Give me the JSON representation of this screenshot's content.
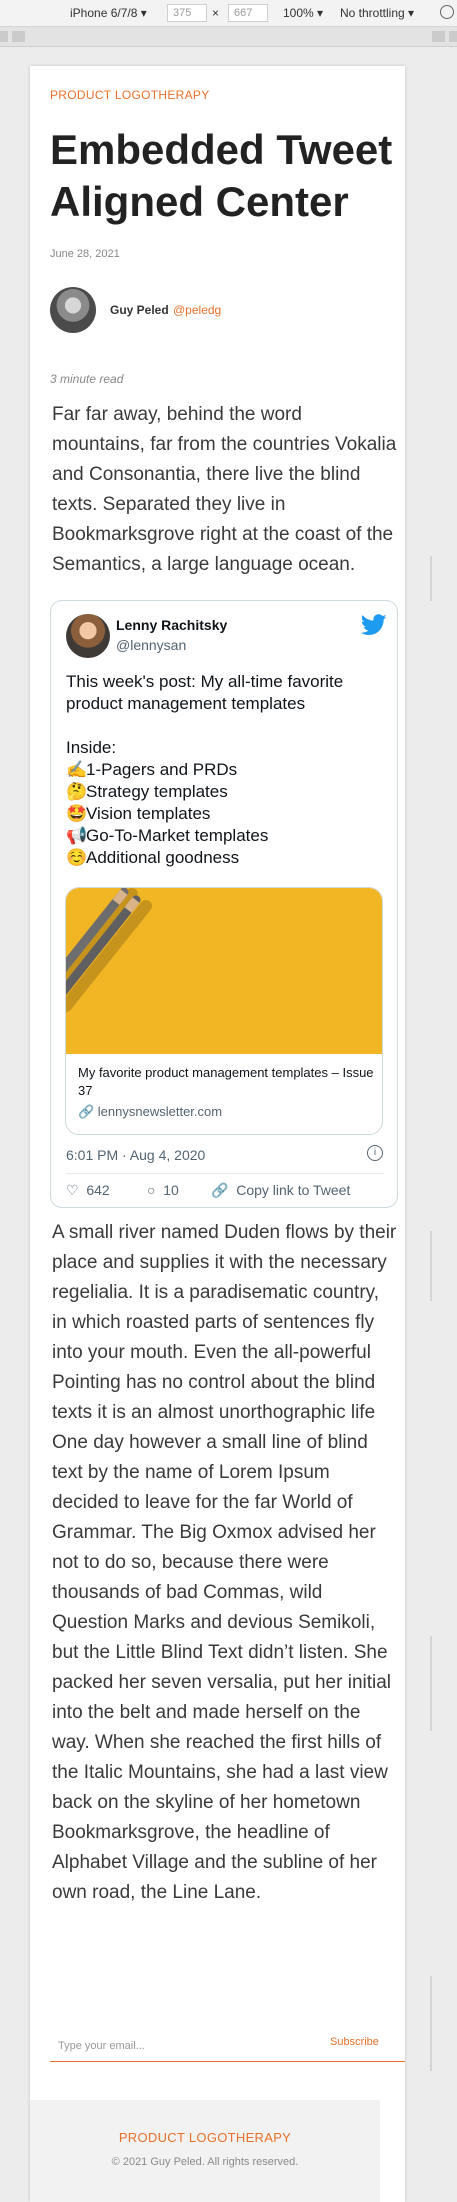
{
  "devtools": {
    "device": "iPhone 6/7/8 ▾",
    "width": "375",
    "times": "×",
    "height": "667",
    "zoom": "100% ▾",
    "throttling": "No throttling ▾"
  },
  "post": {
    "category": "PRODUCT LOGOTHERAPY",
    "title": "Embedded Tweet Aligned Center",
    "date": "June 28, 2021",
    "author_name": "Guy Peled",
    "author_handle": "@peledg",
    "read_time": "3 minute read",
    "paragraph_1": "Far far away, behind the word mountains, far from the countries Vokalia and Consonantia, there live the blind texts. Separated they live in Bookmarksgrove right at the coast of the Semantics, a large language ocean.",
    "paragraph_2": "A small river named Duden flows by their place and supplies it with the necessary regelialia. It is a paradisematic country, in which roasted parts of sentences fly into your mouth. Even the all-powerful Pointing has no control about the blind texts it is an almost unorthographic life One day however a small line of blind text by the name of Lorem Ipsum decided to leave for the far World of Grammar. The Big Oxmox advised her not to do so, because there were thousands of bad Commas, wild Question Marks and devious Semikoli, but the Little Blind Text didn’t listen. She packed her seven versalia, put her initial into the belt and made herself on the way. When she reached the first hills of the Italic Mountains, she had a last view back on the skyline of her hometown Bookmarksgrove, the headline of Alphabet Village and the subline of her own road, the Line Lane."
  },
  "tweet": {
    "name": "Lenny Rachitsky",
    "handle": "@lennysan",
    "intro": "This week's post: My all-time favorite product management templates",
    "inside": "Inside:",
    "items": [
      {
        "emoji": "✍️",
        "text": "1-Pagers and PRDs"
      },
      {
        "emoji": "🤔",
        "text": "Strategy templates"
      },
      {
        "emoji": "🤩",
        "text": "Vision templates"
      },
      {
        "emoji": "📢",
        "text": "Go-To-Market templates"
      },
      {
        "emoji": "☺️",
        "text": "Additional goodness"
      }
    ],
    "card_title": "My favorite product management templates – Issue 37",
    "card_url": "🔗 lennysnewsletter.com",
    "timestamp": "6:01 PM · Aug 4, 2020",
    "info": "i",
    "likes": "642",
    "replies": "10",
    "copy_link": "Copy link to Tweet",
    "like_icon": "♡",
    "reply_icon": "○",
    "link_icon": "🔗"
  },
  "subscribe": {
    "placeholder": "Type your email...",
    "button": "Subscribe"
  },
  "footer": {
    "brand": "PRODUCT LOGOTHERAPY",
    "copyright": "© 2021 Guy Peled. All rights reserved."
  },
  "colors": {
    "accent": "#e8702a",
    "twitter_blue": "#1d9bf0",
    "card_image": "#f2b523"
  }
}
